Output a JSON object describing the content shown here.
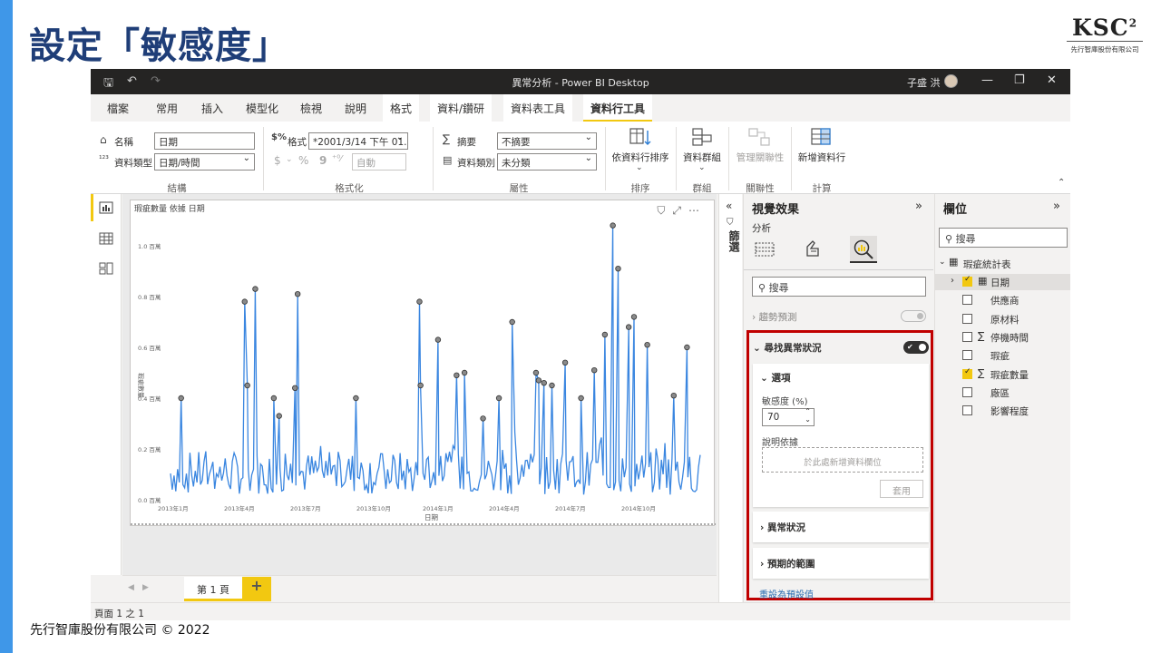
{
  "slide": {
    "title": "設定「敏感度」",
    "logo_text": "KSC",
    "logo_sup": "2",
    "logo_sub": "先行智庫股份有限公司",
    "footer": "先行智庫股份有限公司 © 2022",
    "accent_color": "#3f97e8",
    "title_color": "#1f3e78"
  },
  "window": {
    "title": "異常分析 - Power BI Desktop",
    "user": "子盛 洪"
  },
  "tabs": [
    "檔案",
    "常用",
    "插入",
    "模型化",
    "檢視",
    "說明",
    "格式",
    "資料/鑽研",
    "資料表工具",
    "資料行工具"
  ],
  "active_tab": "資料行工具",
  "ribbon": {
    "structure": {
      "name_label": "名稱",
      "name_value": "日期",
      "type_label": "資料類型",
      "type_value": "日期/時間",
      "group": "結構"
    },
    "formatting": {
      "format_label": "格式",
      "format_value": "*2001/3/14 下午 01...",
      "currency_symbol": "$",
      "percent_symbol": "%",
      "comma_symbol": "9",
      "auto_value": "自動",
      "group": "格式化"
    },
    "properties": {
      "summary_label": "摘要",
      "summary_value": "不摘要",
      "category_label": "資料類別",
      "category_value": "未分類",
      "group": "屬性"
    },
    "sort": {
      "button": "依資料行排序",
      "group": "排序"
    },
    "groups": {
      "button": "資料群組",
      "group": "群組"
    },
    "relationships": {
      "button": "管理關聯性",
      "group": "關聯性"
    },
    "calc": {
      "button": "新增資料行",
      "group": "計算"
    }
  },
  "visual": {
    "title": "瑕疵數量 依據 日期",
    "toolbar_icons": "⛉ ⤢ ⋯"
  },
  "chart_data": {
    "type": "line",
    "xlabel": "日期",
    "ylabel": "瑕疵數量",
    "ylim": [
      0,
      1.1
    ],
    "yticks": [
      "0.0 百萬",
      "0.2 百萬",
      "0.4 百萬",
      "0.6 百萬",
      "0.8 百萬",
      "1.0 百萬"
    ],
    "xticks": [
      "2013年1月",
      "2013年4月",
      "2013年7月",
      "2013年10月",
      "2014年1月",
      "2014年4月",
      "2014年7月",
      "2014年10月"
    ],
    "anomalies": [
      {
        "t": 0.02,
        "v": 0.4
      },
      {
        "t": 0.14,
        "v": 0.78
      },
      {
        "t": 0.145,
        "v": 0.45
      },
      {
        "t": 0.16,
        "v": 0.83
      },
      {
        "t": 0.195,
        "v": 0.4
      },
      {
        "t": 0.205,
        "v": 0.33
      },
      {
        "t": 0.235,
        "v": 0.44
      },
      {
        "t": 0.24,
        "v": 0.81
      },
      {
        "t": 0.35,
        "v": 0.4
      },
      {
        "t": 0.47,
        "v": 0.78
      },
      {
        "t": 0.472,
        "v": 0.45
      },
      {
        "t": 0.505,
        "v": 0.63
      },
      {
        "t": 0.54,
        "v": 0.49
      },
      {
        "t": 0.555,
        "v": 0.5
      },
      {
        "t": 0.59,
        "v": 0.32
      },
      {
        "t": 0.62,
        "v": 0.4
      },
      {
        "t": 0.645,
        "v": 0.7
      },
      {
        "t": 0.69,
        "v": 0.5
      },
      {
        "t": 0.695,
        "v": 0.47
      },
      {
        "t": 0.705,
        "v": 0.46
      },
      {
        "t": 0.72,
        "v": 0.45
      },
      {
        "t": 0.745,
        "v": 0.54
      },
      {
        "t": 0.775,
        "v": 0.4
      },
      {
        "t": 0.8,
        "v": 0.51
      },
      {
        "t": 0.82,
        "v": 0.65
      },
      {
        "t": 0.835,
        "v": 1.08
      },
      {
        "t": 0.845,
        "v": 0.91
      },
      {
        "t": 0.865,
        "v": 0.68
      },
      {
        "t": 0.875,
        "v": 0.72
      },
      {
        "t": 0.9,
        "v": 0.61
      },
      {
        "t": 0.95,
        "v": 0.41
      },
      {
        "t": 0.975,
        "v": 0.6
      }
    ],
    "series_color": "#3a86e0",
    "anomaly_color": "#666666"
  },
  "page": {
    "tab": "第 1 頁",
    "add": "+",
    "status": "頁面 1 之 1"
  },
  "filters_pane": {
    "label": "篩選"
  },
  "viz_pane": {
    "title": "視覺效果",
    "subtitle": "分析",
    "search_placeholder": "搜尋",
    "trend": "趨勢預測",
    "anomaly": {
      "header": "尋找異常狀況",
      "options_title": "選項",
      "sensitivity_label": "敏感度 (%)",
      "sensitivity_value": "70",
      "explain_label": "說明依據",
      "drop_hint": "於此處新增資料欄位",
      "apply": "套用",
      "anomaly_section": "異常狀況",
      "expected_section": "預期的範圍",
      "reset": "重設為預設值",
      "highlight_color": "#c00000"
    }
  },
  "fields_pane": {
    "title": "欄位",
    "search_placeholder": "搜尋",
    "table": "瑕疵統計表",
    "fields": [
      {
        "name": "日期",
        "checked": true,
        "sigma": false,
        "calendar": true
      },
      {
        "name": "供應商",
        "checked": false,
        "sigma": false
      },
      {
        "name": "原材料",
        "checked": false,
        "sigma": false
      },
      {
        "name": "停機時間",
        "checked": false,
        "sigma": true
      },
      {
        "name": "瑕疵",
        "checked": false,
        "sigma": false
      },
      {
        "name": "瑕疵數量",
        "checked": true,
        "sigma": true
      },
      {
        "name": "廠區",
        "checked": false,
        "sigma": false
      },
      {
        "name": "影響程度",
        "checked": false,
        "sigma": false
      }
    ]
  }
}
